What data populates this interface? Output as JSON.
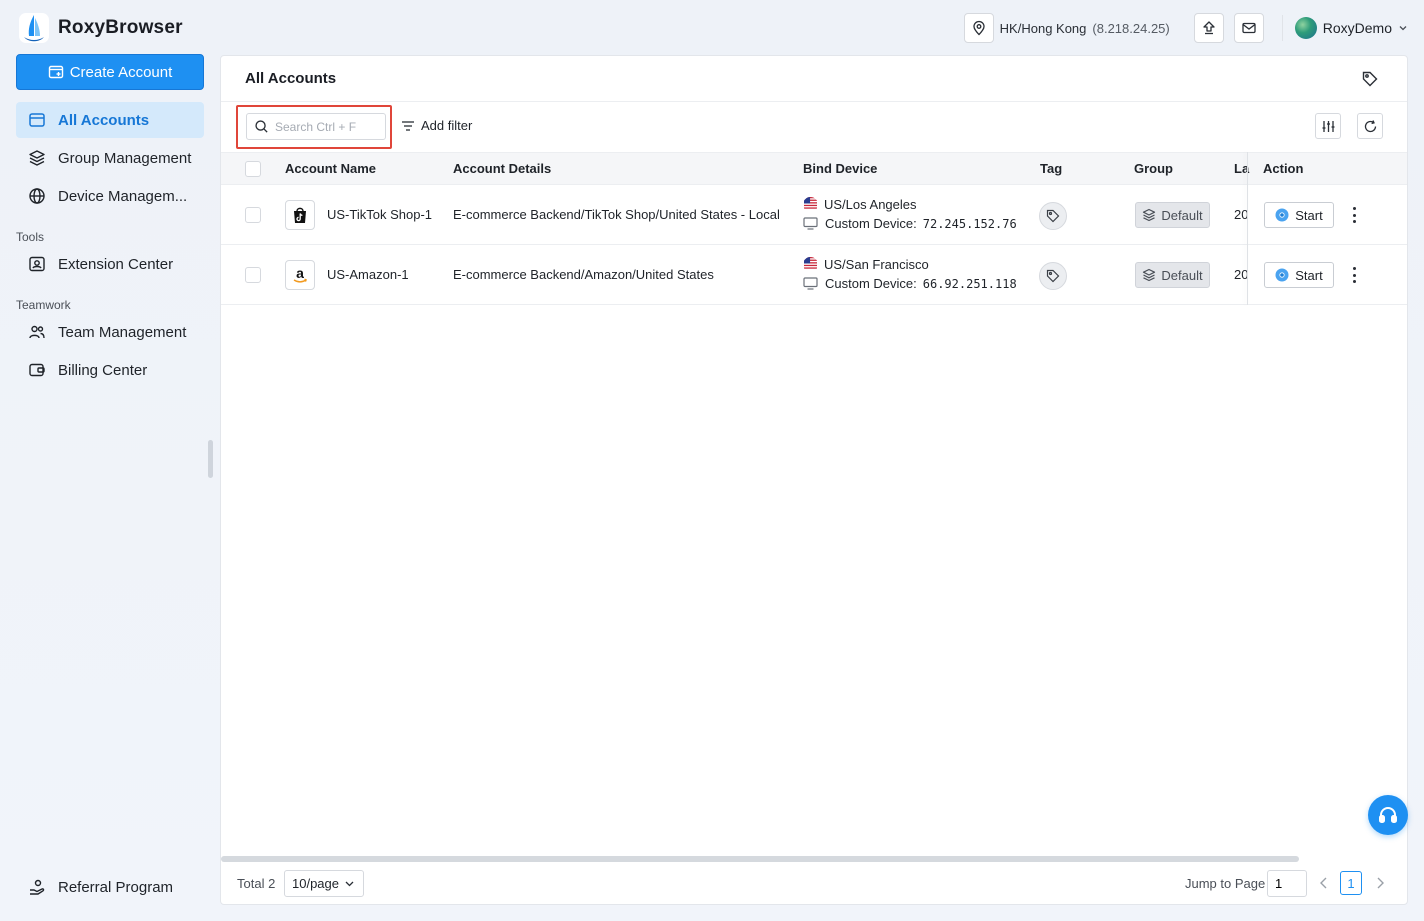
{
  "app": {
    "name": "RoxyBrowser"
  },
  "header": {
    "location": "HK/Hong Kong",
    "ip": "(8.218.24.25)",
    "user_name": "RoxyDemo"
  },
  "sidebar": {
    "create_label": "Create Account",
    "items": [
      {
        "label": "All Accounts",
        "icon": "id-card-icon"
      },
      {
        "label": "Group Management",
        "icon": "layers-icon"
      },
      {
        "label": "Device Managem...",
        "icon": "globe-icon"
      }
    ],
    "tools_label": "Tools",
    "tools": [
      {
        "label": "Extension Center",
        "icon": "extension-icon"
      }
    ],
    "teamwork_label": "Teamwork",
    "teamwork": [
      {
        "label": "Team Management",
        "icon": "users-icon"
      },
      {
        "label": "Billing Center",
        "icon": "wallet-icon"
      }
    ],
    "referral_label": "Referral Program"
  },
  "main": {
    "title": "All Accounts",
    "search_placeholder": "Search Ctrl + F",
    "add_filter_label": "Add filter",
    "columns": [
      "Account Name",
      "Account Details",
      "Bind Device",
      "Tag",
      "Group",
      "La",
      "Action"
    ],
    "rows": [
      {
        "name": "US-TikTok Shop-1",
        "app_icon": "tiktok-shop-icon",
        "details": "E-commerce Backend/TikTok Shop/United States - Local",
        "location": "US/Los Angeles",
        "device_label": "Custom Device:",
        "device_ip": "72.245.152.76",
        "group": "Default",
        "last": "20",
        "action": "Start"
      },
      {
        "name": "US-Amazon-1",
        "app_icon": "amazon-icon",
        "details": "E-commerce Backend/Amazon/United States",
        "location": "US/San Francisco",
        "device_label": "Custom Device:",
        "device_ip": "66.92.251.118",
        "group": "Default",
        "last": "20",
        "action": "Start"
      }
    ],
    "footer": {
      "total": "Total 2",
      "page_size": "10/page",
      "jump_label": "Jump to Page",
      "jump_value": "1",
      "current_page": "1"
    }
  },
  "colors": {
    "accent": "#1e90f2",
    "active_bg": "#d4e9fb",
    "highlight": "#e0463a"
  }
}
